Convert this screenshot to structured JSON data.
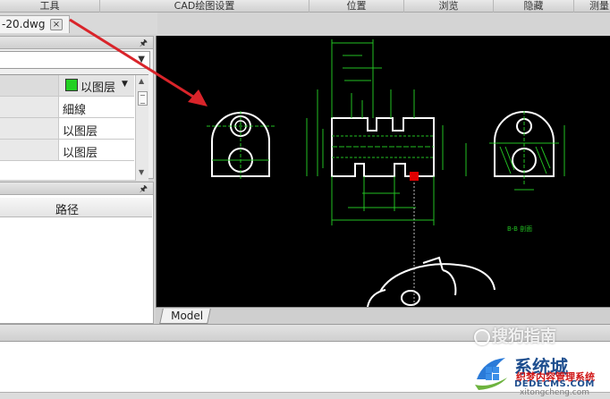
{
  "ribbon": {
    "groups": [
      "工具",
      "CAD绘图设置",
      "位置",
      "浏览",
      "隐藏",
      "测量"
    ]
  },
  "file_tab": {
    "name": "-20.dwg",
    "close": "×"
  },
  "properties": {
    "layer_value": "以图层",
    "rows": [
      "細線",
      "以图层",
      "以图层"
    ],
    "swatch_color": "#22d022"
  },
  "path_panel": {
    "header": "路径"
  },
  "canvas": {
    "model_tab": "Model",
    "section_label": "B-B 剖面"
  },
  "colors": {
    "canvas_bg": "#000000",
    "dimension": "#22c022",
    "outline": "#ffffff",
    "arrow": "#d9242a",
    "marker": "#e00000"
  },
  "watermarks": {
    "sogou": "搜狗指南",
    "brand_big": "系统城",
    "brand_red": "织梦内容管理系统",
    "brand_url": "DEDECMS.COM",
    "brand_small": "xitongcheng.com"
  }
}
